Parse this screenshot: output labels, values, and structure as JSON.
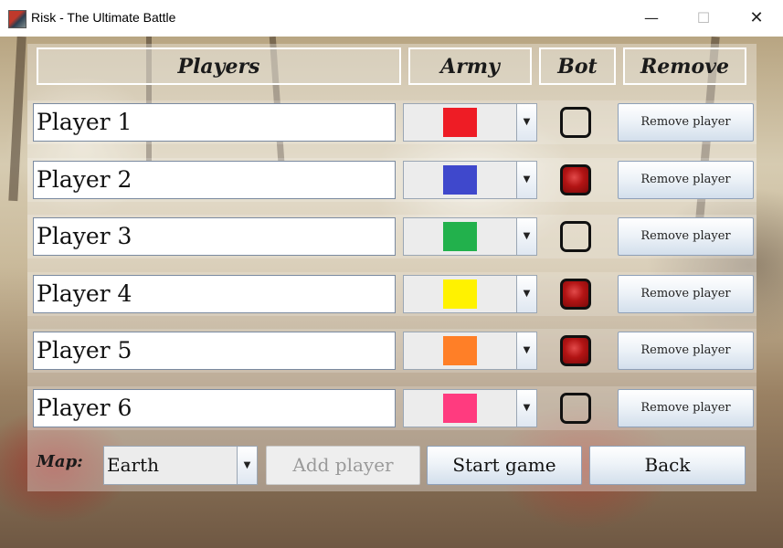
{
  "window": {
    "title": "Risk - The Ultimate Battle",
    "minimize_glyph": "—",
    "maximize_glyph": "☐",
    "close_glyph": "✕"
  },
  "headers": {
    "players": "Players",
    "army": "Army",
    "bot": "Bot",
    "remove": "Remove"
  },
  "players": [
    {
      "name": "Player 1",
      "color": "#ee1c25",
      "bot": false,
      "remove_label": "Remove player"
    },
    {
      "name": "Player 2",
      "color": "#3f48cc",
      "bot": true,
      "remove_label": "Remove player"
    },
    {
      "name": "Player 3",
      "color": "#22b14c",
      "bot": false,
      "remove_label": "Remove player"
    },
    {
      "name": "Player 4",
      "color": "#fff200",
      "bot": true,
      "remove_label": "Remove player"
    },
    {
      "name": "Player 5",
      "color": "#ff7f27",
      "bot": true,
      "remove_label": "Remove player"
    },
    {
      "name": "Player 6",
      "color": "#ff3b7f",
      "bot": false,
      "remove_label": "Remove player"
    }
  ],
  "controls": {
    "map_label": "Map:",
    "map_value": "Earth",
    "add_player": "Add player",
    "start_game": "Start game",
    "back": "Back",
    "dropdown_glyph": "▼"
  }
}
